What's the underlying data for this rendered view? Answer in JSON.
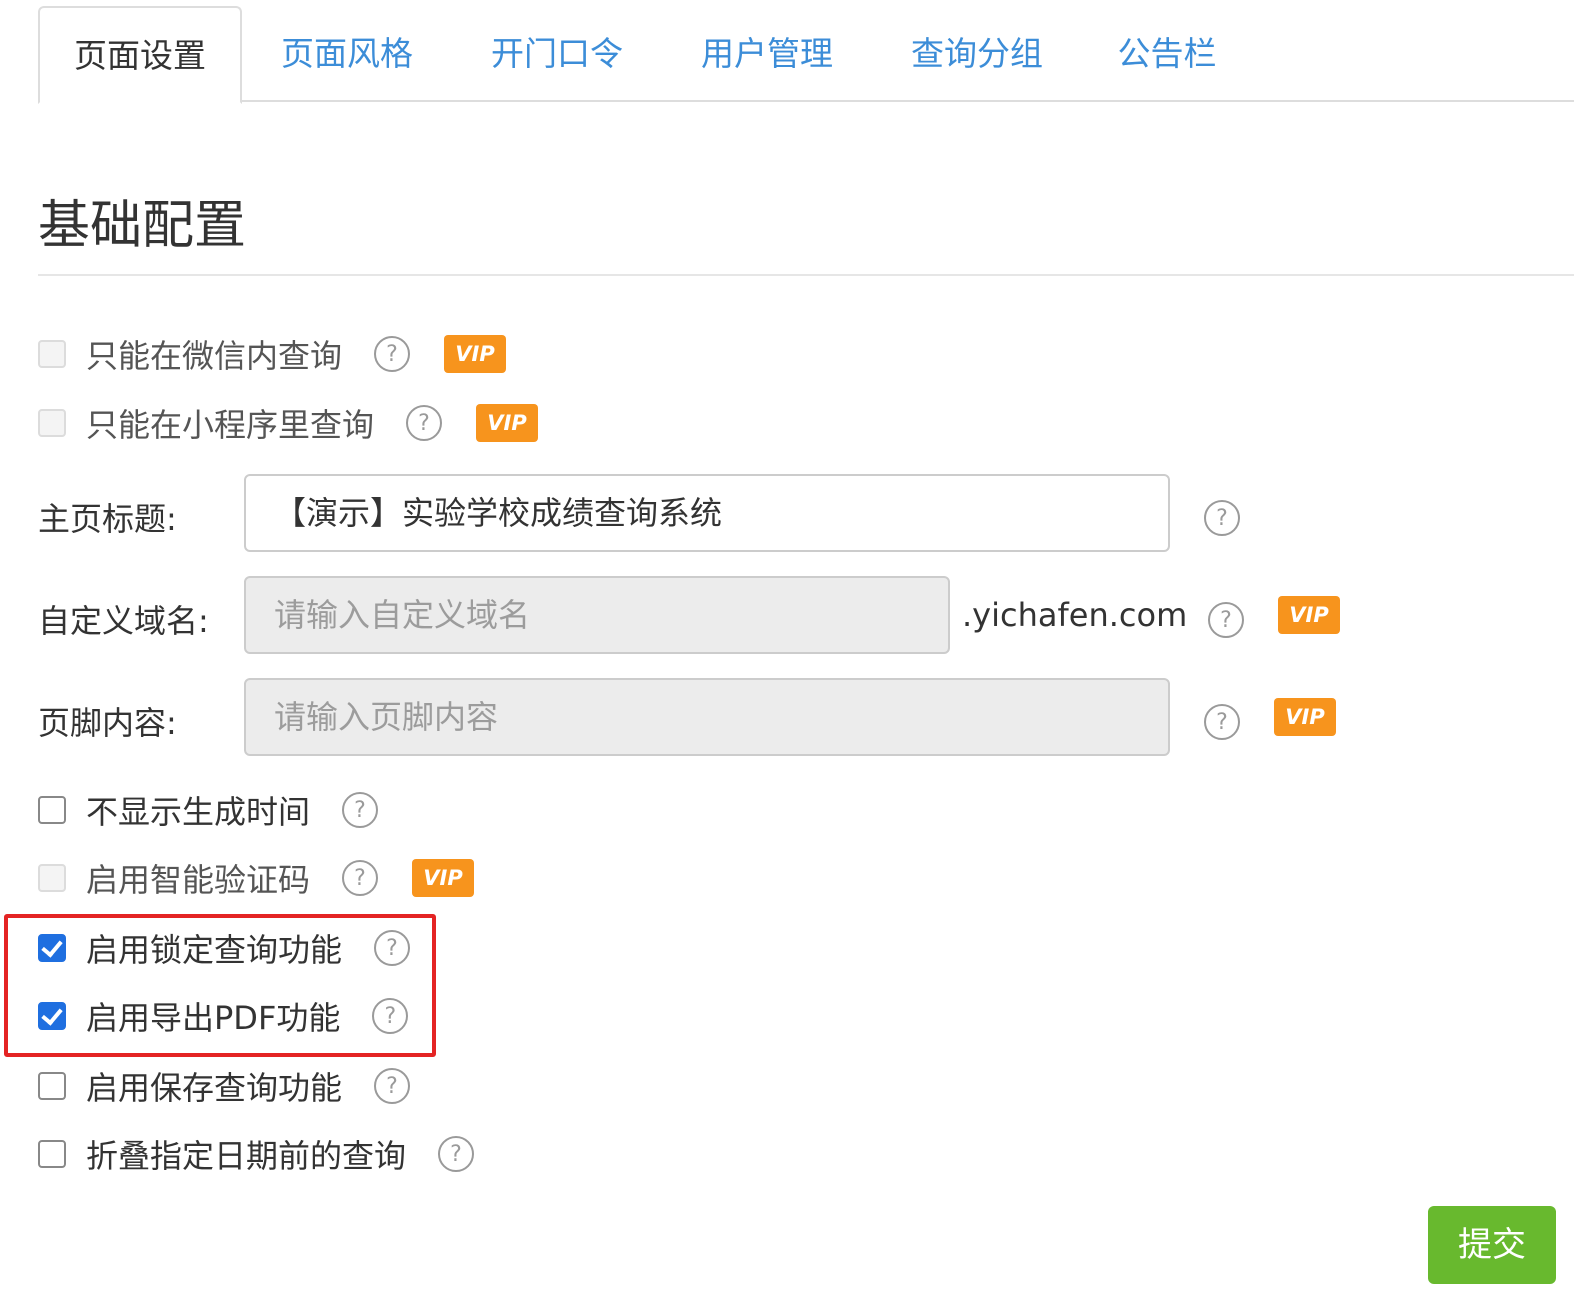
{
  "tabs": [
    {
      "label": "页面设置",
      "active": true
    },
    {
      "label": "页面风格",
      "active": false
    },
    {
      "label": "开门口令",
      "active": false
    },
    {
      "label": "用户管理",
      "active": false
    },
    {
      "label": "查询分组",
      "active": false
    },
    {
      "label": "公告栏",
      "active": false
    }
  ],
  "section_title": "基础配置",
  "vip_label": "VIP",
  "help_glyph": "?",
  "options_top": [
    {
      "label": "只能在微信内查询",
      "checked": false,
      "disabled": true,
      "vip": true
    },
    {
      "label": "只能在小程序里查询",
      "checked": false,
      "disabled": true,
      "vip": true
    }
  ],
  "fields": {
    "homepage_title": {
      "label": "主页标题:",
      "value": "【演示】实验学校成绩查询系统"
    },
    "custom_domain": {
      "label": "自定义域名:",
      "placeholder": "请输入自定义域名",
      "suffix": ".yichafen.com",
      "vip": true
    },
    "footer": {
      "label": "页脚内容:",
      "placeholder": "请输入页脚内容",
      "vip": true
    }
  },
  "options_bottom": [
    {
      "label": "不显示生成时间",
      "checked": false,
      "disabled": false,
      "vip": false
    },
    {
      "label": "启用智能验证码",
      "checked": false,
      "disabled": true,
      "vip": true
    },
    {
      "label": "启用锁定查询功能",
      "checked": true,
      "disabled": false,
      "vip": false
    },
    {
      "label": "启用导出PDF功能",
      "checked": true,
      "disabled": false,
      "vip": false
    },
    {
      "label": "启用保存查询功能",
      "checked": false,
      "disabled": false,
      "vip": false
    },
    {
      "label": "折叠指定日期前的查询",
      "checked": false,
      "disabled": false,
      "vip": false
    }
  ],
  "submit_label": "提交",
  "colors": {
    "tab_link": "#3c8dd8",
    "vip_badge": "#f7941d",
    "checkbox_checked": "#1f6fe0",
    "highlight_border": "#e42424",
    "submit_button": "#68b92e"
  }
}
